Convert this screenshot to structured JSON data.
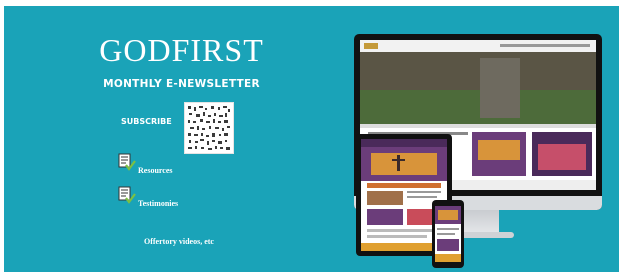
{
  "banner": {
    "title": "GODFIRST",
    "subtitle": "MONTHLY E-NEWSLETTER",
    "subscribe_label": "SUBSCRIBE",
    "items": [
      {
        "label": "Resources",
        "icon": "checklist-icon"
      },
      {
        "label": "Testimonies",
        "icon": "checklist-icon"
      }
    ],
    "offertory": "Offertory videos, etc",
    "colors": {
      "background": "#1aa3b8",
      "text": "#ffffff",
      "check": "#7bc043"
    }
  }
}
